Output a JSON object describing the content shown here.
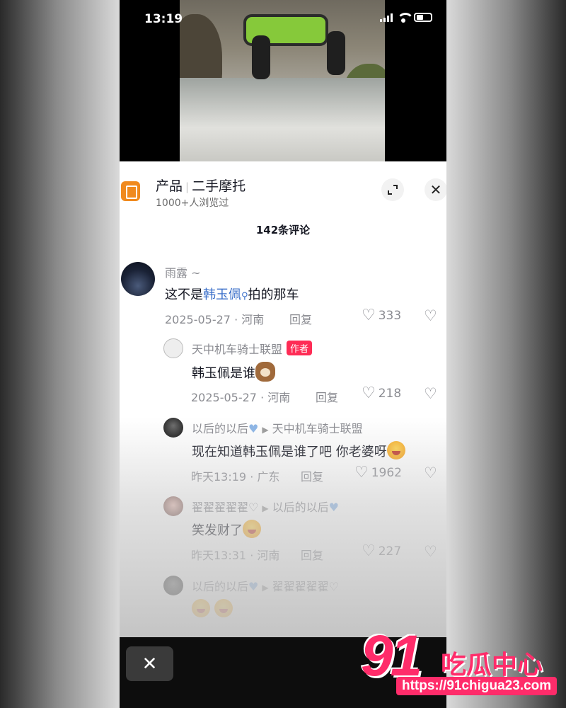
{
  "status_bar": {
    "time": "13:19"
  },
  "product": {
    "category": "产品",
    "name": "二手摩托",
    "views": "1000+人浏览过"
  },
  "comments_header": "142条评论",
  "comments": [
    {
      "user": "雨露 ~",
      "text_prefix": "这不是",
      "mention": "韩玉佩",
      "text_suffix": "拍的那车",
      "date": "2025-05-27 · 河南",
      "reply": "回复",
      "likes": "333"
    },
    {
      "user": "天中机车骑士联盟",
      "badge": "作者",
      "text": "韩玉佩是谁",
      "date": "2025-05-27 · 河南",
      "reply": "回复",
      "likes": "218"
    },
    {
      "user": "以后的以后",
      "reply_to": "天中机车骑士联盟",
      "text": "现在知道韩玉佩是谁了吧 你老婆呀",
      "date": "昨天13:19 · 广东",
      "reply": "回复",
      "likes": "1962"
    },
    {
      "user": "翟翟翟翟翟♡",
      "reply_to": "以后的以后",
      "text": "笑发财了",
      "date": "昨天13:31 · 河南",
      "reply": "回复",
      "likes": "227"
    },
    {
      "user": "以后的以后",
      "reply_to": "翟翟翟翟翟♡",
      "text": ""
    }
  ],
  "watermark": {
    "number": "91",
    "name": "吃瓜中心",
    "url": "https://91chigua23.com"
  },
  "colors": {
    "accent": "#fe2c55",
    "mention": "#3b6fc9",
    "brand_orange": "#f08a1e",
    "watermark": "#ff2c6a"
  }
}
